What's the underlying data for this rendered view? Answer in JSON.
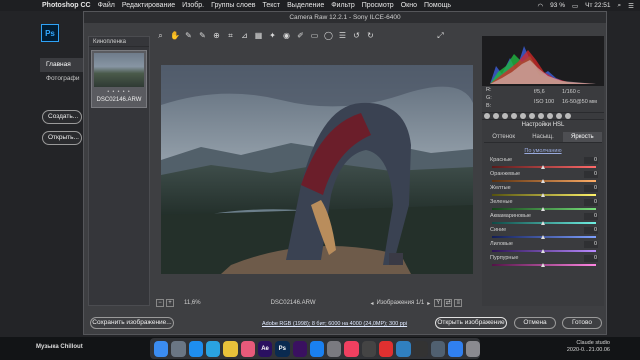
{
  "menubar": {
    "app_name": "Photoshop CC",
    "items": [
      "Файл",
      "Редактирование",
      "Изобр.",
      "Группы слоев",
      "Текст",
      "Выделение",
      "Фильтр",
      "Просмотр",
      "Окно",
      "Помощь"
    ],
    "battery": "93 %",
    "clock": "Чт 22:51"
  },
  "ps": {
    "logo": "Ps",
    "sidebar": [
      "Главная",
      "Фотографи"
    ],
    "btn_create": "Создать...",
    "btn_open": "Открыть..."
  },
  "camera_raw": {
    "title": "Camera Raw 12.2.1  -  Sony ILCE-6400",
    "filmstrip_label": "Кинопленка",
    "thumb_name": "DSC02146.ARW",
    "thumb_stars": "• • • • •",
    "zoom": "11,6%",
    "filename": "DSC02146.ARW",
    "image_counter": "Изображения 1/1",
    "info": {
      "r": "R:",
      "g": "G:",
      "b": "B:",
      "aperture": "f/5,6",
      "shutter": "1/160 с",
      "iso": "ISO 100",
      "lens": "16-50@50 мм"
    },
    "panel_title": "Настройки HSL",
    "tabs": [
      "Оттенок",
      "Насыщ.",
      "Яркость"
    ],
    "active_tab": 2,
    "default_link": "По умолчанию",
    "sliders": [
      {
        "label": "Красные",
        "value": "0",
        "colors": [
          "#5a1a1a",
          "#ff6a6a"
        ]
      },
      {
        "label": "Оранжевые",
        "value": "0",
        "colors": [
          "#5a300f",
          "#ffad66"
        ]
      },
      {
        "label": "Желтые",
        "value": "0",
        "colors": [
          "#55520f",
          "#fff36a"
        ]
      },
      {
        "label": "Зеленые",
        "value": "0",
        "colors": [
          "#15451a",
          "#77e07a"
        ]
      },
      {
        "label": "Аквамариновые",
        "value": "0",
        "colors": [
          "#0f4a46",
          "#6ff0e3"
        ]
      },
      {
        "label": "Синие",
        "value": "0",
        "colors": [
          "#121d55",
          "#7ea0ff"
        ]
      },
      {
        "label": "Лиловые",
        "value": "0",
        "colors": [
          "#2c1355",
          "#b98aff"
        ]
      },
      {
        "label": "Пурпурные",
        "value": "0",
        "colors": [
          "#531347",
          "#ff86e2"
        ]
      }
    ],
    "btn_save": "Сохранить изображение...",
    "workflow": "Adobe RGB (1998); 8 бит; 6000 на 4000 (24,0MP); 300 ppi",
    "btn_open_image": "Открыть изображение",
    "btn_cancel": "Отмена",
    "btn_done": "Готово"
  },
  "dock": {
    "music_label": "Музыка Chillout",
    "apps": [
      {
        "name": "finder",
        "label": "",
        "color": "#3b8cf0"
      },
      {
        "name": "launchpad",
        "label": "",
        "color": "#6a7684"
      },
      {
        "name": "safari",
        "label": "",
        "color": "#1e8ef0"
      },
      {
        "name": "telegram",
        "label": "",
        "color": "#2aa3e0"
      },
      {
        "name": "chrome",
        "label": "",
        "color": "#e8c23a"
      },
      {
        "name": "photos",
        "label": "",
        "color": "#e85a7a"
      },
      {
        "name": "after-effects",
        "label": "Ae",
        "color": "#2a1060"
      },
      {
        "name": "photoshop",
        "label": "Ps",
        "color": "#0a2a50"
      },
      {
        "name": "premiere",
        "label": "",
        "color": "#3a1060"
      },
      {
        "name": "app-store",
        "label": "",
        "color": "#1a80f0"
      },
      {
        "name": "settings",
        "label": "",
        "color": "#7a7a80"
      },
      {
        "name": "music",
        "label": "",
        "color": "#f04060"
      },
      {
        "name": "final-cut",
        "label": "",
        "color": "#444"
      },
      {
        "name": "cloud",
        "label": "",
        "color": "#e03030"
      },
      {
        "name": "preview",
        "label": "",
        "color": "#3080c0"
      },
      {
        "name": "notes",
        "label": "",
        "color": "#333"
      },
      {
        "name": "images",
        "label": "",
        "color": "#506070"
      },
      {
        "name": "finder2",
        "label": "",
        "color": "#3080f0"
      },
      {
        "name": "trash",
        "label": "",
        "color": "#8a8a90"
      }
    ]
  },
  "watermark": {
    "line1": "Claude studio",
    "line2": "2020-0...21.00.06"
  }
}
